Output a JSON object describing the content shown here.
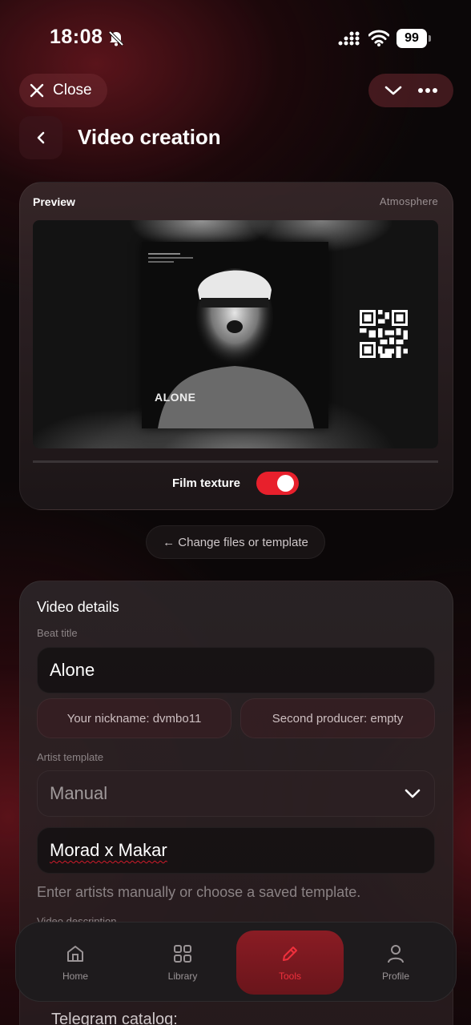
{
  "status_bar": {
    "time": "18:08",
    "battery": "99"
  },
  "header": {
    "close_label": "Close",
    "title": "Video creation"
  },
  "preview": {
    "label": "Preview",
    "template_name": "Atmosphere",
    "cover_title": "ALONE",
    "film_texture_label": "Film texture",
    "film_texture_on": true
  },
  "change_button": "← Change files or template",
  "details": {
    "title": "Video details",
    "beat_title_label": "Beat title",
    "beat_title_value": "Alone",
    "nickname_chip": "Your nickname: dvmbo11",
    "second_producer_chip": "Second producer: empty",
    "artist_template_label": "Artist template",
    "artist_template_value": "Manual",
    "artists_value": "Morad x Makar",
    "artists_help": "Enter artists manually or choose a saved template.",
    "video_description_label": "Video description"
  },
  "nav": {
    "home": "Home",
    "library": "Library",
    "tools": "Tools",
    "profile": "Profile",
    "active": "tools"
  },
  "below_nav_text": "Telegram catalog:",
  "colors": {
    "accent": "#e8202c"
  }
}
